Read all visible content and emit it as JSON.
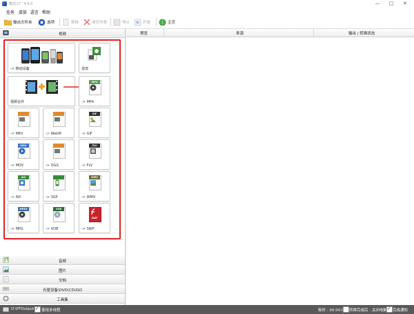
{
  "window": {
    "title": "格式工厂 4.4.0",
    "controls": [
      "—",
      "□",
      "✕"
    ]
  },
  "menu": [
    "任务",
    "皮肤",
    "语言",
    "帮助"
  ],
  "toolbar": {
    "output_folder": "输出文件夹",
    "options": "选项",
    "remove": "移除",
    "clear_list": "清空列表",
    "stop": "停止",
    "start": "开始",
    "home": "主页"
  },
  "categories": {
    "video": "视频",
    "audio": "音频",
    "picture": "图片",
    "document": "文档",
    "rom": "光驱设备\\DVD\\CD\\ISO",
    "tools": "工具集"
  },
  "tiles": {
    "mobile": "-> 移动设备",
    "mix": "混流",
    "join": "视频合并",
    "mp4": "-> MP4",
    "mkv": "-> MKV",
    "webm": "-> WebM",
    "gif": "-> GIF",
    "mov": "-> MOV",
    "ogg": "-> OGG",
    "flv": "-> FLV",
    "avi": "-> AVI",
    "3gp": "-> 3GP",
    "wmv": "-> WMV",
    "mpg": "-> MPG",
    "vob": "-> VOB",
    "swf": "-> SWF"
  },
  "badges": {
    "mp4": "MP4",
    "gif": "GIF",
    "mov": "MOV",
    "flv": "FLV",
    "avi": "AVI",
    "wmv": "WMV",
    "mpg": "MPEG",
    "vob": "VOB",
    "swf": "SWF"
  },
  "task_list": {
    "col_preview": "预览",
    "col_source": "来源",
    "col_output": "输出 / 转换状态"
  },
  "status": {
    "output_path": "D:\\FFOutput",
    "multithread": "使用多线程",
    "elapsed": "耗时 : 00:00:00",
    "shutdown": "转换完成后 : 关闭电脑",
    "notify": "完成通知"
  },
  "colors": {
    "accent_red": "#e02020",
    "status_bg": "#595959"
  }
}
